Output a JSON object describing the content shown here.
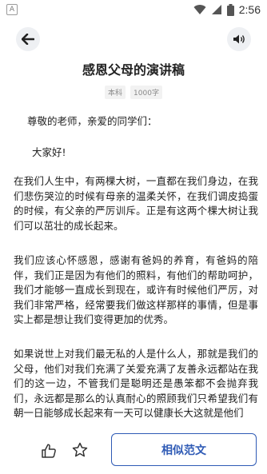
{
  "status_bar": {
    "app_icon_letter": "A",
    "time": "2:56",
    "icons": [
      "wifi-icon",
      "cell-signal-icon",
      "battery-icon"
    ]
  },
  "nav": {
    "back_icon": "back-arrow-icon",
    "speaker_icon": "speaker-icon"
  },
  "article": {
    "title": "感恩父母的演讲稿",
    "tag": "本科",
    "word_count": "1000字",
    "salutation": "尊敬的老师，亲爱的同学们：",
    "greeting": "大家好!",
    "paragraphs": [
      "在我们人生中，有两棵大树，一直都在我们身边，在我们悲伤哭泣的时候有母亲的温柔关怀，在我们调皮捣蛋的时候，有父亲的严厉训斥。正是有这两个棵大树让我们可以茁壮的成长起来。",
      "我们应该心怀感恩，感谢有爸妈的养育，有爸妈的陪伴，我们正是因为有他们的照料，有他们的帮助呵护，我们才能够一直成长到现在，或许有时候他们严厉，对我们非常严格，经常要我们做这样那样的事情，但是事实上都是想让我们变得更加的优秀。",
      "如果说世上对我们最无私的人是什么人，那就是我们的父母，他们对我们充满了关爱充满了友善永远都站在我们的这一边，不管我们是聪明还是愚笨都不会抛弃我们，永远都是那么的认真耐心的照顾我们只希望我们有朝一日能够成长起来有一天可以健康长大这就是他们"
    ]
  },
  "bottom": {
    "like_icon": "thumbs-up-icon",
    "favorite_icon": "star-icon",
    "similar_label": "相似范文"
  },
  "colors": {
    "accent": "#2e5ab5",
    "nav_button_bg": "#eef0f3",
    "text": "#222222",
    "meta_text": "#888888"
  }
}
